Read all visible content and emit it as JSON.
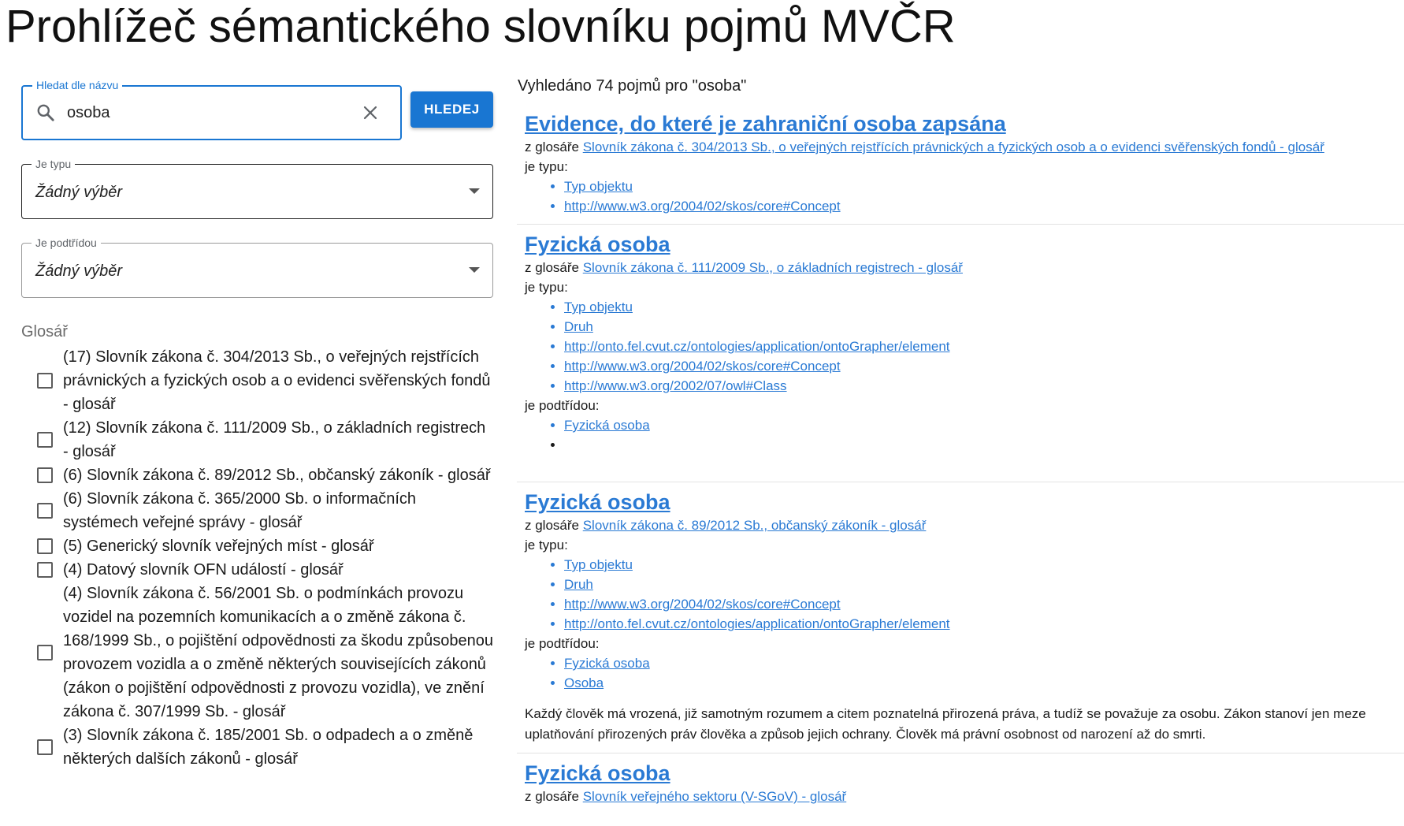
{
  "page": {
    "title": "Prohlížeč sémantického slovníku pojmů MVČR"
  },
  "search": {
    "legend": "Hledat dle názvu",
    "value": "osoba",
    "button_label": "HLEDEJ"
  },
  "filters": {
    "type": {
      "legend": "Je typu",
      "value": "Žádný výběr"
    },
    "subclass": {
      "legend": "Je podtřídou",
      "value": "Žádný výběr"
    }
  },
  "glossary": {
    "heading": "Glosář",
    "items": [
      {
        "label": "(17) Slovník zákona č. 304/2013 Sb., o veřejných rejstřících právnických a fyzických osob a o evidenci svěřenských fondů - glosář"
      },
      {
        "label": "(12) Slovník zákona č. 111/2009 Sb., o základních registrech - glosář"
      },
      {
        "label": "(6) Slovník zákona č. 89/2012 Sb., občanský zákoník - glosář"
      },
      {
        "label": "(6) Slovník zákona č. 365/2000 Sb. o informačních systémech veřejné správy - glosář"
      },
      {
        "label": "(5) Generický slovník veřejných míst - glosář"
      },
      {
        "label": "(4) Datový slovník OFN událostí - glosář"
      },
      {
        "label": "(4) Slovník zákona č. 56/2001 Sb. o podmínkách provozu vozidel na pozemních komunikacích a o změně zákona č. 168/1999 Sb., o pojištění odpovědnosti za škodu způsobenou provozem vozidla a o změně některých souvisejících zákonů (zákon o pojištění odpovědnosti z provozu vozidla), ve znění zákona č. 307/1999 Sb. - glosář"
      },
      {
        "label": "(3) Slovník zákona č. 185/2001 Sb. o odpadech a o změně některých dalších zákonů - glosář"
      }
    ]
  },
  "results": {
    "count_text": "Vyhledáno 74 pojmů pro \"osoba\"",
    "labels": {
      "from_glossary": "z glosáře",
      "is_type": "je typu:",
      "is_subclass": "je podtřídou:"
    },
    "items": [
      {
        "title": "Evidence, do které je zahraniční osoba zapsána",
        "glossary": "Slovník zákona č. 304/2013 Sb., o veřejných rejstřících právnických a fyzických osob a o evidenci svěřenských fondů - glosář",
        "types": [
          "Typ objektu",
          "http://www.w3.org/2004/02/skos/core#Concept"
        ]
      },
      {
        "title": "Fyzická osoba",
        "glossary": "Slovník zákona č. 111/2009 Sb., o základních registrech - glosář",
        "types": [
          "Typ objektu",
          "Druh",
          "http://onto.fel.cvut.cz/ontologies/application/ontoGrapher/element",
          "http://www.w3.org/2004/02/skos/core#Concept",
          "http://www.w3.org/2002/07/owl#Class"
        ],
        "subclasses": [
          "Fyzická osoba",
          ""
        ]
      },
      {
        "title": "Fyzická osoba",
        "glossary": "Slovník zákona č. 89/2012 Sb., občanský zákoník - glosář",
        "types": [
          "Typ objektu",
          "Druh",
          "http://www.w3.org/2004/02/skos/core#Concept",
          "http://onto.fel.cvut.cz/ontologies/application/ontoGrapher/element"
        ],
        "subclasses": [
          "Fyzická osoba",
          "Osoba"
        ],
        "description": "Každý člověk má vrozená, již samotným rozumem a citem poznatelná přirozená práva, a tudíž se považuje za osobu. Zákon stanoví jen meze uplatňování přirozených práv člověka a způsob jejich ochrany. Člověk má právní osobnost od narození až do smrti."
      },
      {
        "title": "Fyzická osoba",
        "glossary": "Slovník veřejného sektoru (V-SGoV) - glosář"
      }
    ]
  },
  "colors": {
    "accent": "#1976d2",
    "link": "#2a7ad4"
  },
  "icons": {
    "search": "search-icon",
    "clear": "close-icon",
    "dropdown": "caret-down-icon",
    "checkbox": "checkbox-unchecked-icon"
  }
}
